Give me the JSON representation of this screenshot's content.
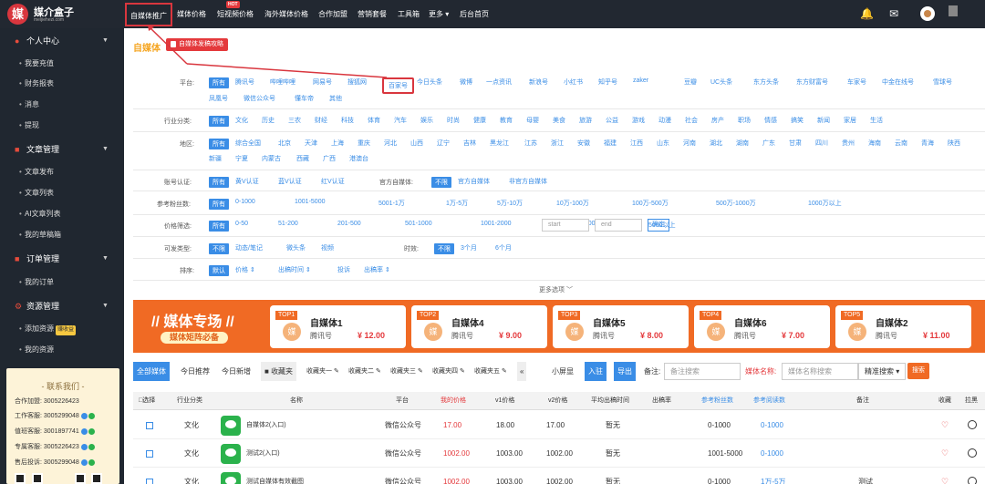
{
  "topbar": {
    "logo_mark": "媒",
    "logo_title": "媒介盒子",
    "logo_domain": "meijiehezi.com",
    "nav": [
      "自媒体推广",
      "媒体价格",
      "短视频价格",
      "海外媒体价格",
      "合作加盟",
      "营销套餐",
      "工具箱",
      "更多 ▾",
      "后台首页"
    ],
    "hot_badge": "HOT",
    "icons": [
      "bell-icon",
      "mail-icon",
      "user-avatar",
      "menu-icon"
    ]
  },
  "sidebar": {
    "sections": [
      {
        "label": "个人中心",
        "icon": "user-icon",
        "items": [
          "我要充值",
          "财务报表",
          "消息",
          "提现"
        ]
      },
      {
        "label": "文章管理",
        "icon": "document-icon",
        "items": [
          "文章发布",
          "文章列表",
          "AI文章列表",
          "我的草稿箱"
        ]
      },
      {
        "label": "订单管理",
        "icon": "order-icon",
        "items": [
          "我的订单"
        ]
      },
      {
        "label": "资源管理",
        "icon": "gear-icon",
        "items": [
          "添加资源",
          "我的资源"
        ]
      }
    ],
    "resource_badge": "赚收益",
    "contact": {
      "title": "- 联系我们 -",
      "lines": [
        "合作加盟: 3005226423",
        "工作客服: 3005299048",
        "值班客服: 3001897741",
        "专属客服: 3005226423",
        "售后投诉: 3005299048"
      ]
    }
  },
  "content": {
    "title": "自媒体",
    "guide_btn": "自媒体发稿攻略",
    "filters": {
      "platform": {
        "label": "平台:",
        "options": [
          "所有",
          "腾讯号",
          "哔哩哔哩",
          "网易号",
          "搜狐网",
          "百家号",
          "今日头条",
          "微博",
          "一点资讯",
          "新浪号",
          "小红书",
          "知乎号",
          "zaker",
          "豆瓣",
          "UC头条",
          "东方头条",
          "东方财富号",
          "车家号",
          "中金在线号",
          "雪球号",
          "凤凰号",
          "微信公众号",
          "懂车帝",
          "其他"
        ]
      },
      "industry": {
        "label": "行业分类:",
        "options": [
          "所有",
          "文化",
          "历史",
          "三农",
          "财经",
          "科技",
          "体育",
          "汽车",
          "娱乐",
          "时尚",
          "健康",
          "教育",
          "母婴",
          "美食",
          "旅游",
          "公益",
          "游戏",
          "动漫",
          "社会",
          "房产",
          "职场",
          "情感",
          "搞笑",
          "新闻",
          "家居",
          "生活"
        ]
      },
      "region": {
        "label": "地区:",
        "options": [
          "所有",
          "综合全国",
          "北京",
          "天津",
          "上海",
          "重庆",
          "河北",
          "山西",
          "辽宁",
          "吉林",
          "黑龙江",
          "江苏",
          "浙江",
          "安徽",
          "福建",
          "江西",
          "山东",
          "河南",
          "湖北",
          "湖南",
          "广东",
          "甘肃",
          "四川",
          "贵州",
          "海南",
          "云南",
          "青海",
          "陕西",
          "新疆",
          "宁夏",
          "内蒙古",
          "西藏",
          "广西",
          "港澳台"
        ]
      },
      "certification": {
        "label": "账号认证:",
        "options": [
          "所有",
          "黄V认证",
          "蓝V认证",
          "红V认证"
        ],
        "official_label": "官方自媒体:",
        "official_options": [
          "不限",
          "官方自媒体",
          "非官方自媒体"
        ]
      },
      "fans": {
        "label": "参考粉丝数:",
        "options": [
          "所有",
          "0-1000",
          "1001-5000",
          "5001-1万",
          "1万-5万",
          "5万-10万",
          "10万-100万",
          "100万-500万",
          "500万-1000万",
          "1000万以上"
        ]
      },
      "price": {
        "label": "价格筛选:",
        "options": [
          "所有",
          "0-50",
          "51-200",
          "201-500",
          "501-1000",
          "1001-2000",
          "2001-5000",
          "5000以上"
        ],
        "start_placeholder": "start",
        "end_placeholder": "end",
        "confirm": "确定"
      },
      "publish_type": {
        "label": "可发类型:",
        "options": [
          "不限",
          "动态/笔记",
          "微头条",
          "视频"
        ],
        "timeliness_label": "时效:",
        "timeliness_options": [
          "不限",
          "3个月",
          "6个月"
        ]
      },
      "sort": {
        "label": "排序:",
        "options": [
          "默认",
          "价格 ⇕",
          "出稿时间 ⇕",
          "投诉",
          "出稿率 ⇕"
        ]
      }
    },
    "more_options": "更多选项 ﹀"
  },
  "banner": {
    "title": "// 媒体专场 //",
    "subtitle": "媒体矩阵必备",
    "cards": [
      {
        "rank": "TOP1",
        "name": "自媒体1",
        "platform": "腾讯号",
        "price": "¥ 12.00"
      },
      {
        "rank": "TOP2",
        "name": "自媒体4",
        "platform": "腾讯号",
        "price": "¥ 9.00"
      },
      {
        "rank": "TOP3",
        "name": "自媒体5",
        "platform": "腾讯号",
        "price": "¥ 8.00"
      },
      {
        "rank": "TOP4",
        "name": "自媒体6",
        "platform": "腾讯号",
        "price": "¥ 7.00"
      },
      {
        "rank": "TOP5",
        "name": "自媒体2",
        "platform": "腾讯号",
        "price": "¥ 11.00"
      }
    ]
  },
  "toolbar": {
    "tabs": [
      "全部媒体",
      "今日推荐",
      "今日新增"
    ],
    "favorites": "收藏夹",
    "folders": [
      "收藏夹一",
      "收藏夹二",
      "收藏夹三",
      "收藏夹四",
      "收藏夹五"
    ],
    "small_screen": "小屏显",
    "import": "入驻",
    "export": "导出",
    "remark_label": "备注:",
    "remark_placeholder": "备注搜索",
    "name_label": "媒体名称:",
    "name_placeholder": "媒体名称搜索",
    "match_mode": "精准搜索",
    "search": "搜索"
  },
  "table": {
    "headers": [
      "□选择",
      "行业分类",
      "名称",
      "平台",
      "我的价格",
      "v1价格",
      "v2价格",
      "平均出稿时间",
      "出稿率",
      "参考粉丝数",
      "参考阅读数",
      "备注",
      "收藏",
      "拉黑"
    ],
    "rows": [
      {
        "industry": "文化",
        "name": "自媒体2(入口)",
        "platform": "微信公众号",
        "my_price": "17.00",
        "v1": "18.00",
        "v2": "17.00",
        "avg_time": "暂无",
        "rate": "",
        "fans": "0-1000",
        "reads": "0-1000",
        "remark": ""
      },
      {
        "industry": "文化",
        "name": "测试2(入口)",
        "platform": "微信公众号",
        "my_price": "1002.00",
        "v1": "1003.00",
        "v2": "1002.00",
        "avg_time": "暂无",
        "rate": "",
        "fans": "1001-5000",
        "reads": "0-1000",
        "remark": ""
      },
      {
        "industry": "文化",
        "name": "测试自媒体有效截图",
        "platform": "微信公众号",
        "my_price": "1002.00",
        "v1": "1003.00",
        "v2": "1002.00",
        "avg_time": "暂无",
        "rate": "",
        "fans": "0-1000",
        "reads": "1万-5万",
        "remark": "测试"
      }
    ]
  }
}
